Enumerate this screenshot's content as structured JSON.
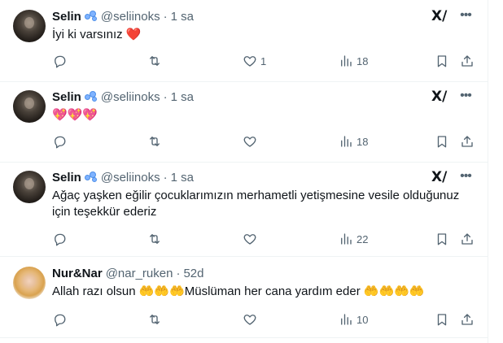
{
  "tweets": [
    {
      "author": "Selin",
      "handle": "@seliinoks",
      "separator": "·",
      "time": "1 sa",
      "text": "İyi ki varsınız",
      "emoji": "❤️",
      "avatar": "dark",
      "replies": "",
      "retweets": "",
      "likes": "1",
      "views": "18"
    },
    {
      "author": "Selin",
      "handle": "@seliinoks",
      "separator": "·",
      "time": "1 sa",
      "text": "",
      "emoji": "💖💖💖",
      "avatar": "dark",
      "replies": "",
      "retweets": "",
      "likes": "",
      "views": "18"
    },
    {
      "author": "Selin",
      "handle": "@seliinoks",
      "separator": "·",
      "time": "1 sa",
      "text_line1": "Ağaç yaşken eğilir çocuklarımızın merhametli yetişmesine vesile olduğunuz",
      "text_line2": "için teşekkür ederiz",
      "avatar": "dark",
      "replies": "",
      "retweets": "",
      "likes": "",
      "views": "22"
    },
    {
      "author": "Nur&Nar",
      "handle": "@nar_ruken",
      "separator": "·",
      "time": "52d",
      "text_a": "Allah razı olsun",
      "emoji_a": "🤲🤲🤲",
      "text_b": "Müslüman her cana yardım eder",
      "emoji_b": "🤲🤲🤲🤲",
      "avatar": "blonde",
      "replies": "",
      "retweets": "",
      "likes": "",
      "views": "10"
    }
  ],
  "icons": {
    "reply": "reply-icon",
    "retweet": "retweet-icon",
    "like": "like-icon",
    "views": "views-icon",
    "bookmark": "bookmark-icon",
    "share": "share-icon",
    "grok": "grok-icon",
    "more": "more-icon",
    "verified": "verified-badge-icon"
  },
  "grok_glyph": "X/",
  "more_glyph": "•••",
  "colors": {
    "text": "#0f1419",
    "muted": "#536471",
    "border": "#eff3f4",
    "heart": "#e0245e"
  }
}
